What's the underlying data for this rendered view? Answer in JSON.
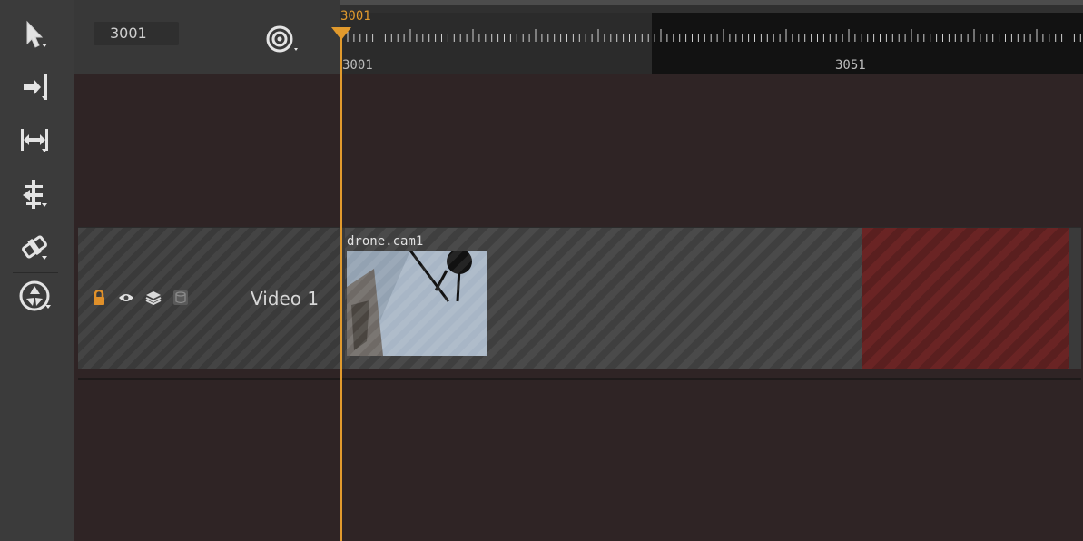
{
  "timecode": "3001",
  "ruler": {
    "playhead_frame": "3001",
    "tick_labels": [
      "3001",
      "3051"
    ]
  },
  "track": {
    "name": "Video 1",
    "clip": {
      "label": "drone.cam1"
    }
  },
  "tools": [
    {
      "name": "select-tool-icon"
    },
    {
      "name": "slip-to-playhead-icon"
    },
    {
      "name": "trim-range-icon"
    },
    {
      "name": "ripple-tool-icon"
    },
    {
      "name": "razor-tool-icon"
    },
    {
      "name": "aperture-tool-icon"
    }
  ],
  "colors": {
    "playhead": "#e19a2d",
    "missing_media": "#6a2424",
    "toolbar_bg": "#3b3b3b",
    "track_area_bg": "#2f2425"
  }
}
